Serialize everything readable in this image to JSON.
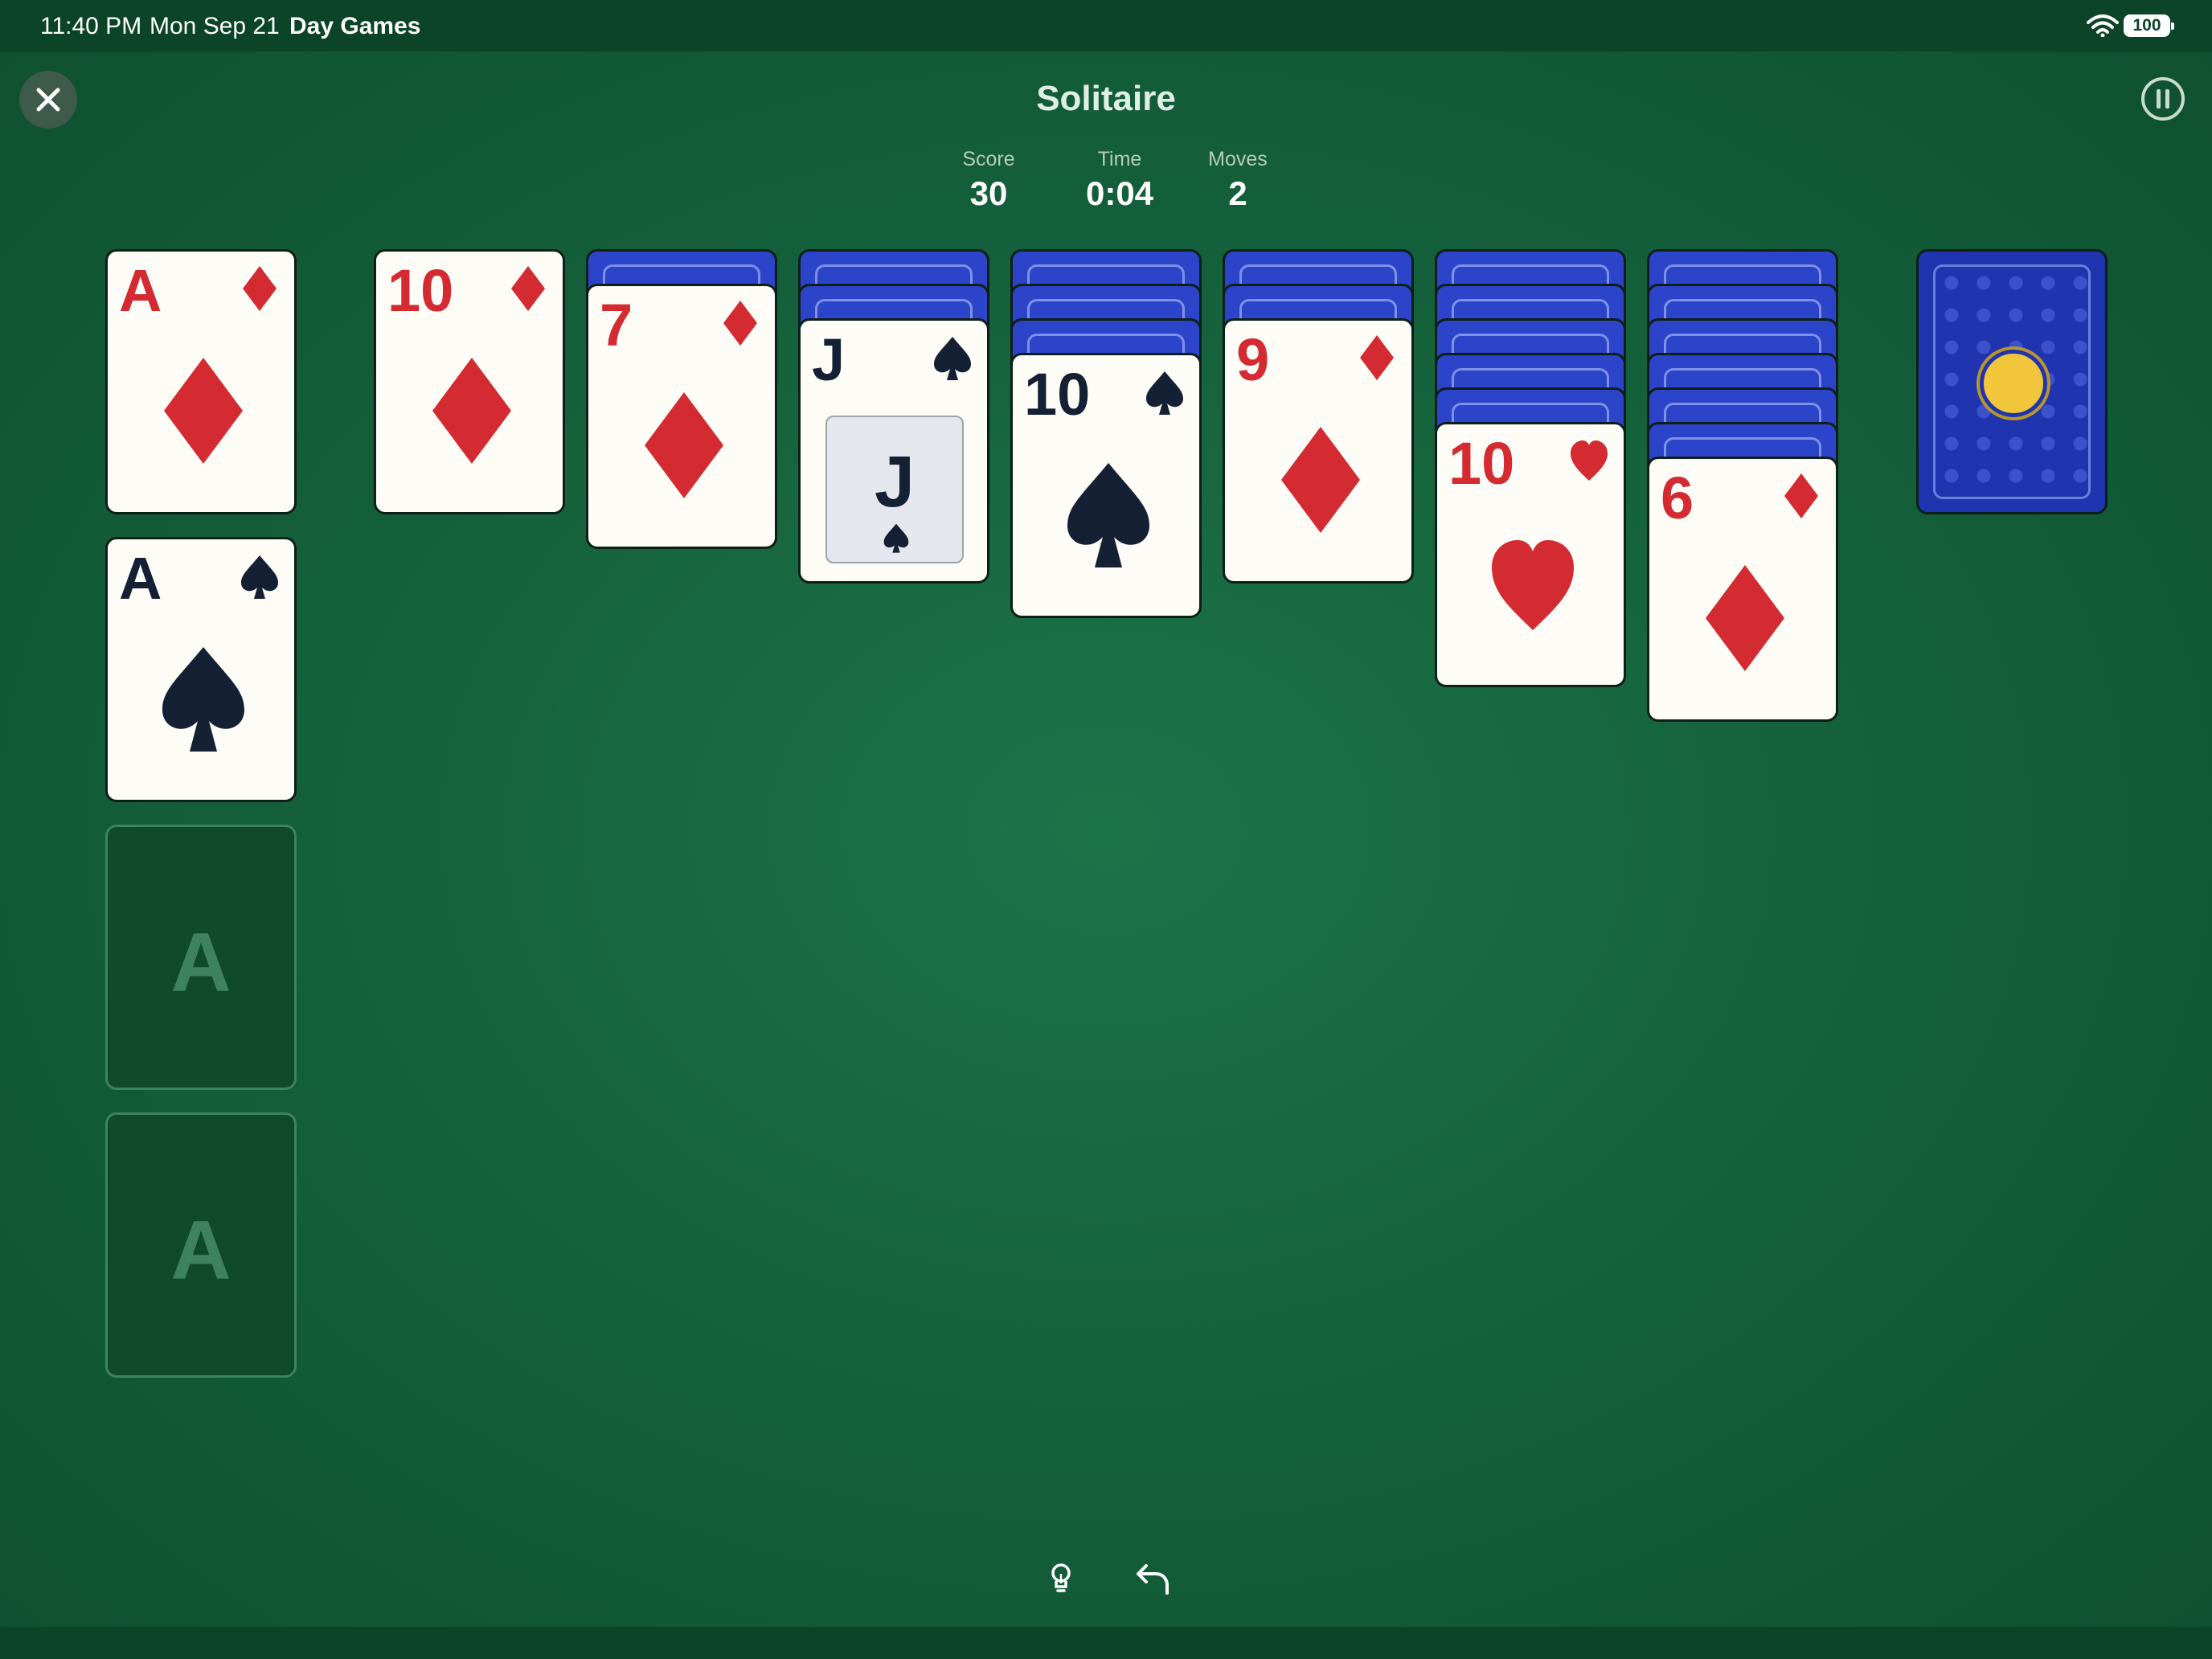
{
  "status_bar": {
    "time": "11:40 PM",
    "date": "Mon Sep 21",
    "app_name": "Day Games",
    "battery": "100"
  },
  "header": {
    "title": "Solitaire"
  },
  "stats": [
    {
      "label": "Score",
      "value": "30"
    },
    {
      "label": "Time",
      "value": "0:04"
    },
    {
      "label": "Moves",
      "value": "2"
    }
  ],
  "foundations": [
    {
      "rank": "A",
      "suit": "diamond",
      "color": "red"
    },
    {
      "rank": "A",
      "suit": "spade",
      "color": "black"
    },
    {
      "placeholder": "A"
    },
    {
      "placeholder": "A"
    }
  ],
  "tableau": [
    {
      "hidden": 0,
      "top_card": {
        "rank": "10",
        "suit": "diamond",
        "color": "red"
      }
    },
    {
      "hidden": 1,
      "top_card": {
        "rank": "7",
        "suit": "diamond",
        "color": "red"
      }
    },
    {
      "hidden": 2,
      "top_card": {
        "rank": "J",
        "suit": "spade",
        "color": "black",
        "face": true
      }
    },
    {
      "hidden": 3,
      "top_card": {
        "rank": "10",
        "suit": "spade",
        "color": "black"
      }
    },
    {
      "hidden": 2,
      "top_card": {
        "rank": "9",
        "suit": "diamond",
        "color": "red"
      }
    },
    {
      "hidden": 5,
      "top_card": {
        "rank": "10",
        "suit": "heart",
        "color": "red"
      }
    },
    {
      "hidden": 6,
      "top_card": {
        "rank": "6",
        "suit": "diamond",
        "color": "red"
      }
    }
  ],
  "colors": {
    "felt": "#1c7449",
    "red_suit": "#d42a31",
    "black_suit": "#152034",
    "card_back": "#2c44c9",
    "coin": "#f2c63a"
  },
  "controls": {
    "close": "close-icon",
    "pause": "pause-icon",
    "hint": "lightbulb-icon",
    "undo": "undo-icon"
  }
}
